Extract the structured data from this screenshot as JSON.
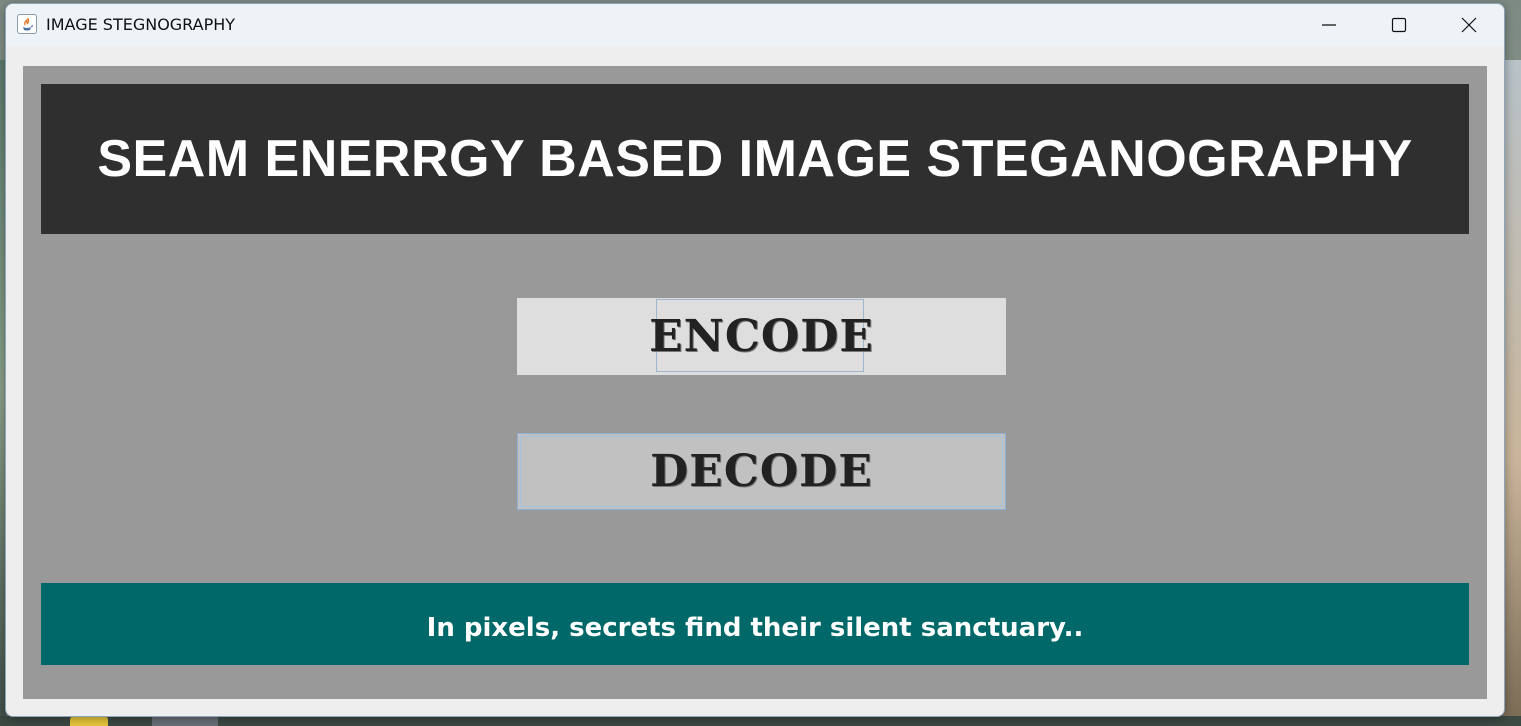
{
  "window": {
    "title": "IMAGE STEGNOGRAPHY",
    "app_icon": "java-icon",
    "controls": {
      "minimize_icon": "minimize-icon",
      "maximize_icon": "maximize-icon",
      "close_icon": "close-icon"
    }
  },
  "header": {
    "title": "SEAM ENERRGY BASED IMAGE STEGANOGRAPHY"
  },
  "actions": {
    "encode_label": "ENCODE",
    "decode_label": "DECODE"
  },
  "footer": {
    "tagline": "In pixels, secrets find their silent sanctuary.."
  },
  "colors": {
    "content_bg": "#999999",
    "header_bg": "#2f2f2f",
    "footer_bg": "#006868",
    "encode_bg": "#dedede",
    "decode_bg": "#c1c1c1"
  }
}
